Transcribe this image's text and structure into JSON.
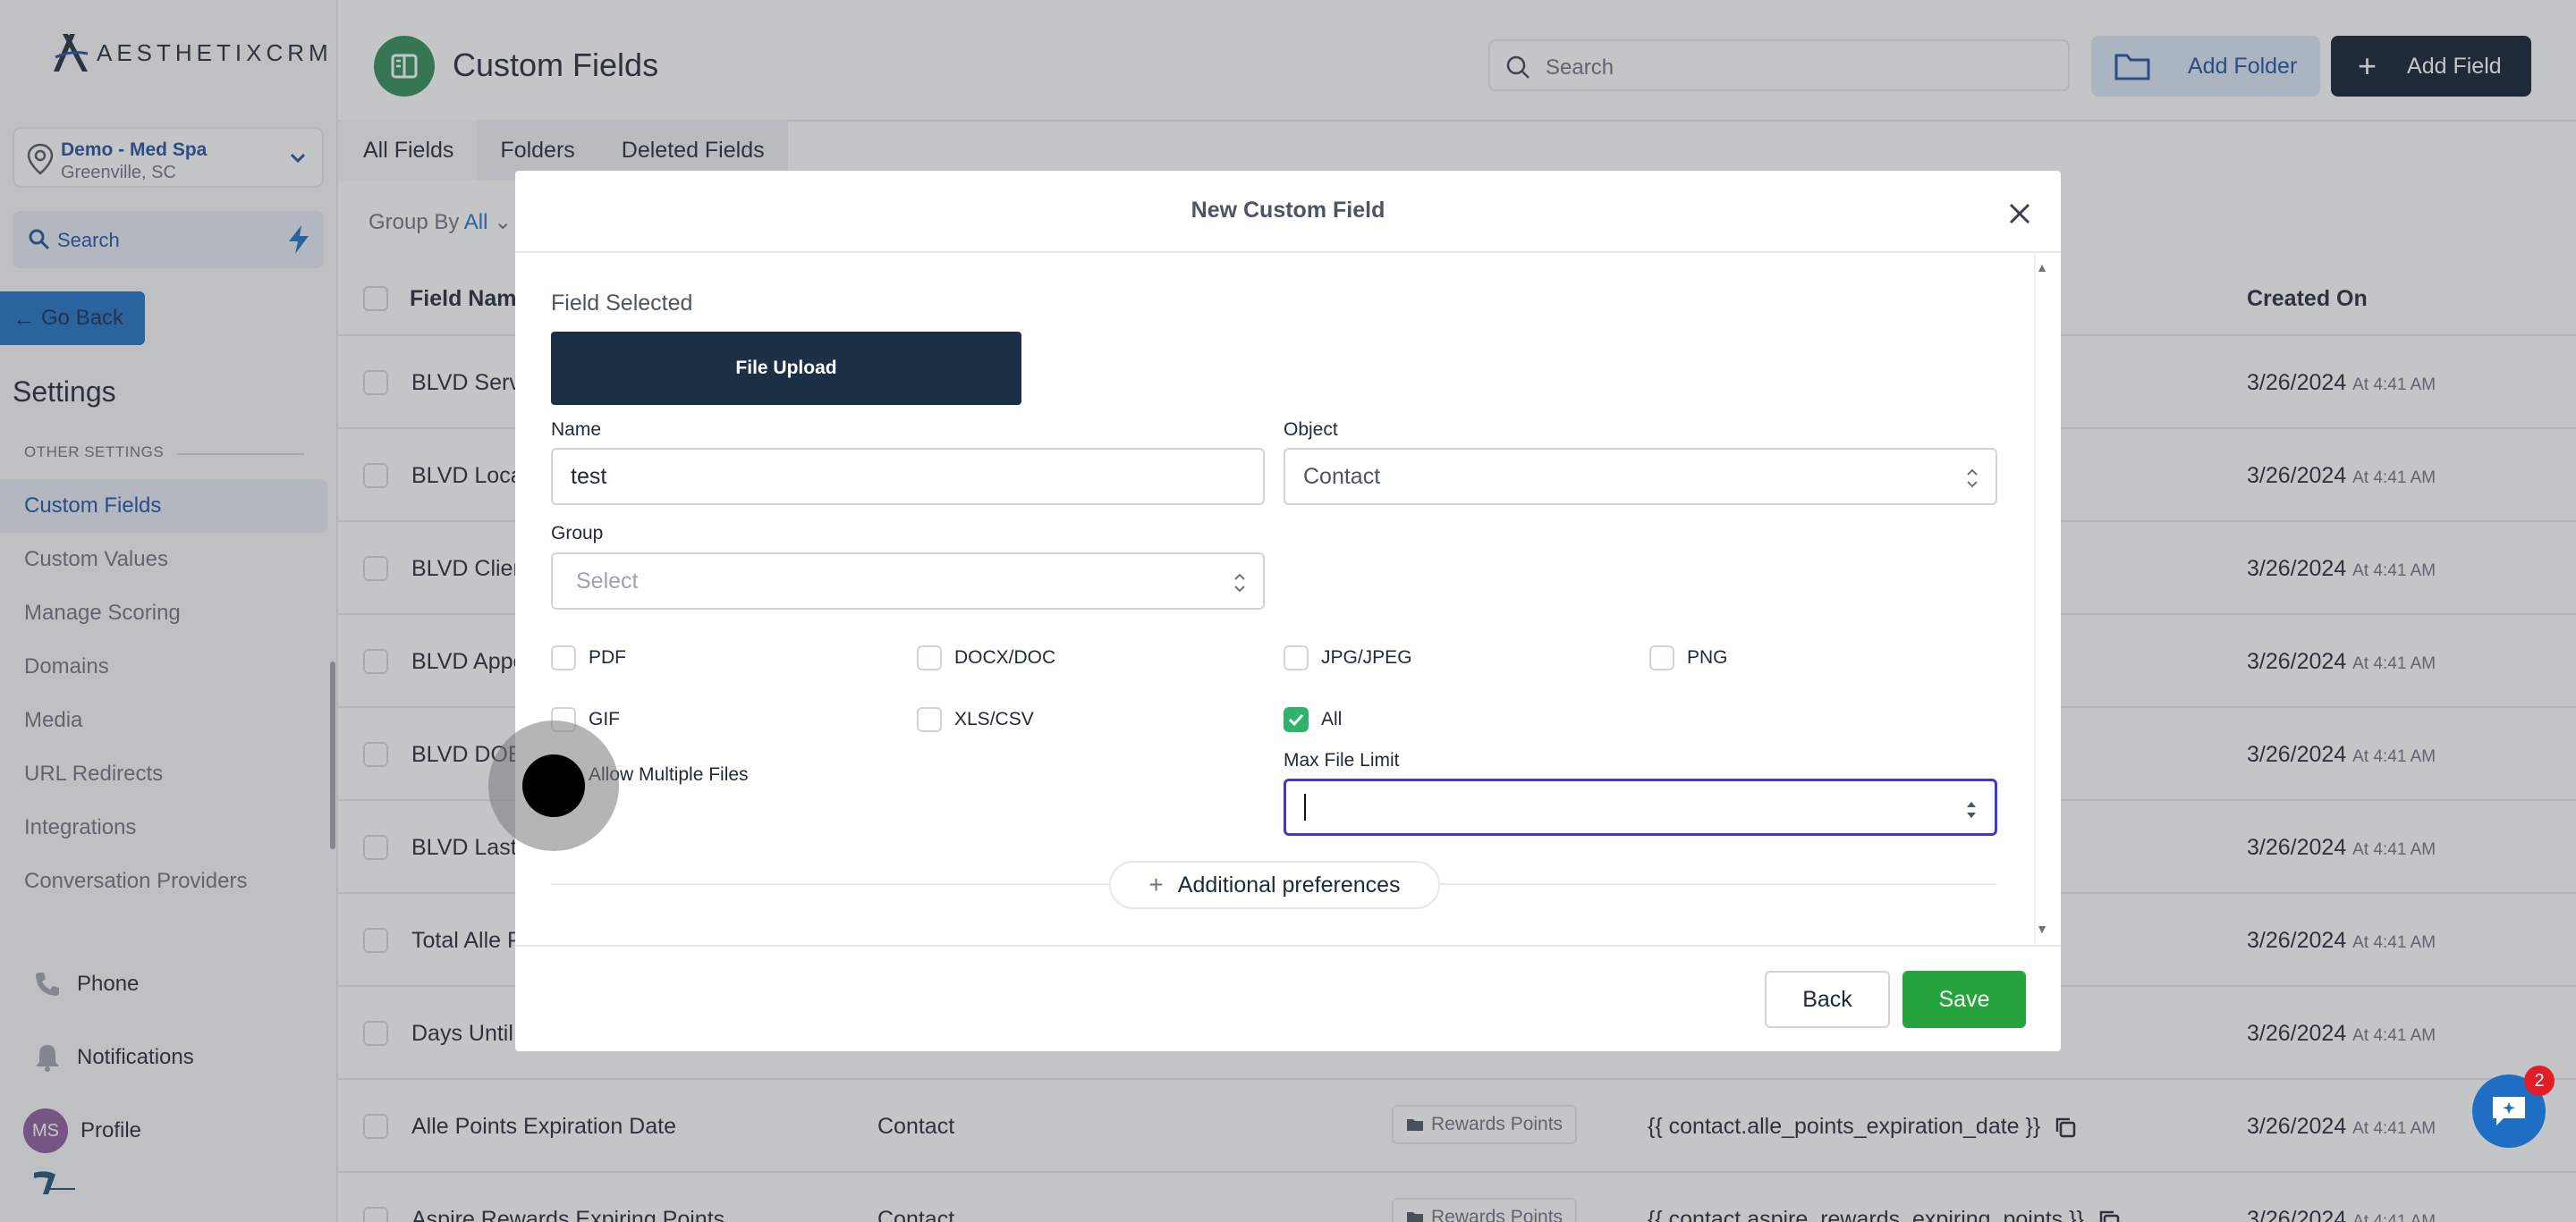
{
  "brand": {
    "name": "AESTHETIXCRM"
  },
  "location": {
    "name": "Demo - Med Spa",
    "city": "Greenville, SC"
  },
  "sidebar": {
    "search_label": "Search",
    "go_back": "Go Back",
    "settings_title": "Settings",
    "section_label": "OTHER SETTINGS",
    "items": [
      {
        "label": "Custom Fields",
        "active": true
      },
      {
        "label": "Custom Values"
      },
      {
        "label": "Manage Scoring"
      },
      {
        "label": "Domains"
      },
      {
        "label": "Media"
      },
      {
        "label": "URL Redirects"
      },
      {
        "label": "Integrations"
      },
      {
        "label": "Conversation Providers"
      }
    ],
    "bottom": [
      {
        "label": "Phone",
        "icon": "phone-icon"
      },
      {
        "label": "Notifications",
        "icon": "bell-icon"
      },
      {
        "label": "Profile",
        "initials": "MS"
      }
    ]
  },
  "header": {
    "title": "Custom Fields",
    "search_placeholder": "Search",
    "add_folder": "Add Folder",
    "add_field": "Add Field"
  },
  "tabs": [
    "All Fields",
    "Folders",
    "Deleted Fields"
  ],
  "group_by": {
    "label": "Group By",
    "value": "All"
  },
  "table": {
    "columns": {
      "name": "Field Name",
      "created": "Created On"
    },
    "rows": [
      {
        "name": "BLVD Serv",
        "object": "",
        "folder": "",
        "key": "",
        "date": "3/26/2024",
        "time": "At 4:41 AM"
      },
      {
        "name": "BLVD Loca",
        "object": "",
        "folder": "",
        "key": "",
        "date": "3/26/2024",
        "time": "At 4:41 AM"
      },
      {
        "name": "BLVD Clien",
        "object": "",
        "folder": "",
        "key": "",
        "date": "3/26/2024",
        "time": "At 4:41 AM"
      },
      {
        "name": "BLVD Appo",
        "object": "",
        "folder": "",
        "key": "",
        "date": "3/26/2024",
        "time": "At 4:41 AM"
      },
      {
        "name": "BLVD DOB",
        "object": "",
        "folder": "",
        "key": "",
        "date": "3/26/2024",
        "time": "At 4:41 AM"
      },
      {
        "name": "BLVD Last",
        "object": "",
        "folder": "",
        "key": "",
        "date": "3/26/2024",
        "time": "At 4:41 AM"
      },
      {
        "name": "Total Alle P",
        "object": "",
        "folder": "",
        "key": "",
        "date": "3/26/2024",
        "time": "At 4:41 AM"
      },
      {
        "name": "Days Until",
        "object": "",
        "folder": "",
        "key": "",
        "date": "3/26/2024",
        "time": "At 4:41 AM"
      },
      {
        "name": "Alle Points Expiration Date",
        "object": "Contact",
        "folder": "Rewards Points",
        "key": "{{ contact.alle_points_expiration_date }}",
        "date": "3/26/2024",
        "time": "At 4:41 AM"
      },
      {
        "name": "Aspire Rewards Expiring Points",
        "object": "Contact",
        "folder": "Rewards Points",
        "key": "{{ contact.aspire_rewards_expiring_points }}",
        "date": "3/26/2024",
        "time": "At 4:41 AM"
      }
    ]
  },
  "modal": {
    "title": "New Custom Field",
    "field_selected_label": "Field Selected",
    "field_type": "File Upload",
    "name_label": "Name",
    "name_value": "test",
    "object_label": "Object",
    "object_value": "Contact",
    "group_label": "Group",
    "group_placeholder": "Select",
    "file_types": [
      {
        "label": "PDF",
        "checked": false
      },
      {
        "label": "DOCX/DOC",
        "checked": false
      },
      {
        "label": "JPG/JPEG",
        "checked": false
      },
      {
        "label": "PNG",
        "checked": false
      },
      {
        "label": "GIF",
        "checked": false
      },
      {
        "label": "XLS/CSV",
        "checked": false
      },
      {
        "label": "All",
        "checked": true
      }
    ],
    "allow_multiple_label": "Allow Multiple Files",
    "max_file_label": "Max File Limit",
    "max_file_value": "",
    "additional_prefs": "Additional preferences",
    "back": "Back",
    "save": "Save"
  },
  "chat": {
    "badge": "2"
  },
  "colors": {
    "primary": "#1e4fa0",
    "save_green": "#27a33d",
    "file_upload_bg": "#1b2f45",
    "add_field_bg": "#0e1a2b"
  }
}
